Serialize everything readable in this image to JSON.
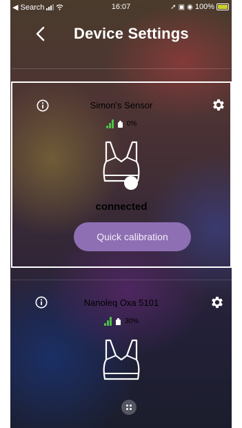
{
  "status_bar": {
    "back_label": "◀ Search",
    "time": "16:07",
    "battery_percent": "100%",
    "icons": [
      "signal-icon",
      "wifi-icon",
      "location-icon",
      "lock-rotation-icon",
      "alarm-icon",
      "battery-icon"
    ]
  },
  "header": {
    "title": "Device Settings",
    "back_icon": "chevron-left-icon"
  },
  "devices": [
    {
      "name": "Simon's Sensor",
      "battery": "0%",
      "status": "connected",
      "selected": true,
      "action_label": "Quick calibration",
      "icons": [
        "info-icon",
        "gear-icon",
        "signal-strength-icon",
        "battery-icon",
        "sports-bra-icon"
      ]
    },
    {
      "name": "Nanoleq Oxa 5101",
      "battery": "30%",
      "selected": false,
      "icons": [
        "info-icon",
        "gear-icon",
        "signal-strength-icon",
        "battery-icon",
        "sports-bra-icon",
        "drag-handle-icon"
      ]
    }
  ],
  "colors": {
    "accent_button": "#8e6fb3",
    "signal_green": "#4ec34a",
    "status_battery": "#c9d02b"
  }
}
